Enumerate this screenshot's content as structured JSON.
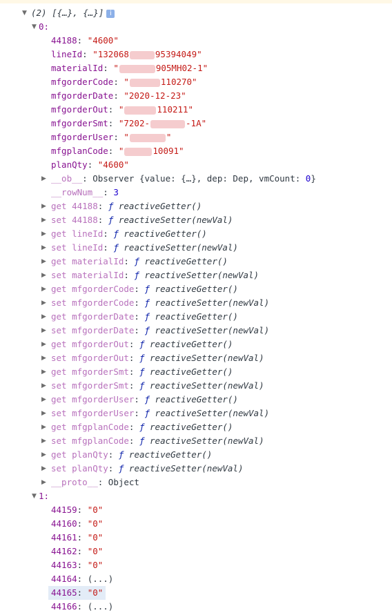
{
  "console": {
    "array_summary": "(2) [{…}, {…}]",
    "info_badge": "i",
    "item0": {
      "index": "0:",
      "props": [
        {
          "key": "44188",
          "value": "\"4600\""
        },
        {
          "key": "lineId",
          "value_a": "\"132068",
          "value_b": "95394049\""
        },
        {
          "key": "materialId",
          "value_a": "\"",
          "value_b": "905MH02-1\""
        },
        {
          "key": "mfgorderCode",
          "value_a": "\"",
          "value_b": "110270\""
        },
        {
          "key": "mfgorderDate",
          "value": "\"2020-12-23\""
        },
        {
          "key": "mfgorderOut",
          "value_a": "\"",
          "value_b": "110211\""
        },
        {
          "key": "mfgorderSmt",
          "value_a": "\"7202-",
          "value_b": "-1A\""
        },
        {
          "key": "mfgorderUser",
          "value_a": "\"",
          "value_b": "\""
        },
        {
          "key": "mfgplanCode",
          "value_a": "\"",
          "value_b": "10091\""
        },
        {
          "key": "planQty",
          "value": "\"4600\""
        }
      ],
      "ob_key": "__ob__",
      "ob_value_prefix": "Observer {value: {…}, dep: Dep, vmCount: ",
      "ob_vmcount": "0",
      "ob_value_suffix": "}",
      "rownum_key": "__rowNum__",
      "rownum_value": "3",
      "accessors": [
        {
          "kind": "get",
          "prop": "44188",
          "fn": "reactiveGetter()"
        },
        {
          "kind": "set",
          "prop": "44188",
          "fn": "reactiveSetter(newVal)"
        },
        {
          "kind": "get",
          "prop": "lineId",
          "fn": "reactiveGetter()"
        },
        {
          "kind": "set",
          "prop": "lineId",
          "fn": "reactiveSetter(newVal)"
        },
        {
          "kind": "get",
          "prop": "materialId",
          "fn": "reactiveGetter()"
        },
        {
          "kind": "set",
          "prop": "materialId",
          "fn": "reactiveSetter(newVal)"
        },
        {
          "kind": "get",
          "prop": "mfgorderCode",
          "fn": "reactiveGetter()"
        },
        {
          "kind": "set",
          "prop": "mfgorderCode",
          "fn": "reactiveSetter(newVal)"
        },
        {
          "kind": "get",
          "prop": "mfgorderDate",
          "fn": "reactiveGetter()"
        },
        {
          "kind": "set",
          "prop": "mfgorderDate",
          "fn": "reactiveSetter(newVal)"
        },
        {
          "kind": "get",
          "prop": "mfgorderOut",
          "fn": "reactiveGetter()"
        },
        {
          "kind": "set",
          "prop": "mfgorderOut",
          "fn": "reactiveSetter(newVal)"
        },
        {
          "kind": "get",
          "prop": "mfgorderSmt",
          "fn": "reactiveGetter()"
        },
        {
          "kind": "set",
          "prop": "mfgorderSmt",
          "fn": "reactiveSetter(newVal)"
        },
        {
          "kind": "get",
          "prop": "mfgorderUser",
          "fn": "reactiveGetter()"
        },
        {
          "kind": "set",
          "prop": "mfgorderUser",
          "fn": "reactiveSetter(newVal)"
        },
        {
          "kind": "get",
          "prop": "mfgplanCode",
          "fn": "reactiveGetter()"
        },
        {
          "kind": "set",
          "prop": "mfgplanCode",
          "fn": "reactiveSetter(newVal)"
        },
        {
          "kind": "get",
          "prop": "planQty",
          "fn": "reactiveGetter()"
        },
        {
          "kind": "set",
          "prop": "planQty",
          "fn": "reactiveSetter(newVal)"
        }
      ],
      "function_symbol": "ƒ",
      "proto_key": "__proto__",
      "proto_value": "Object"
    },
    "item1": {
      "index": "1:",
      "props": [
        {
          "key": "44159",
          "value": "\"0\""
        },
        {
          "key": "44160",
          "value": "\"0\""
        },
        {
          "key": "44161",
          "value": "\"0\""
        },
        {
          "key": "44162",
          "value": "\"0\""
        },
        {
          "key": "44163",
          "value": "\"0\""
        },
        {
          "key": "44164",
          "value": "(...)"
        },
        {
          "key": "44165",
          "value": "\"0\""
        },
        {
          "key": "44166",
          "value": "(...)"
        }
      ]
    }
  }
}
